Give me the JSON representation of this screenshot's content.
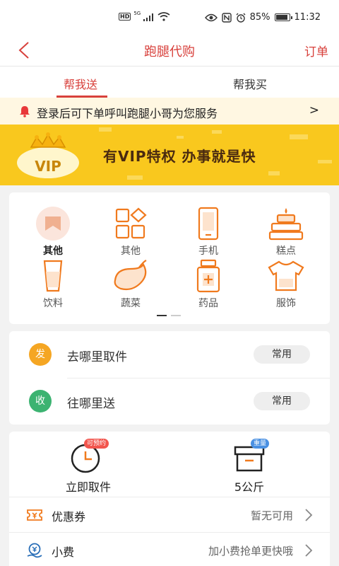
{
  "status_bar": {
    "left_badges": [
      "HD",
      "5G"
    ],
    "battery_percent": "85%",
    "time": "11:32",
    "icons": [
      "eye-icon",
      "nfc-icon",
      "alarm-icon",
      "battery-icon",
      "signal-icon",
      "wifi-icon"
    ]
  },
  "nav": {
    "title": "跑腿代购",
    "order_label": "订单",
    "back_icon": "chevron-left-icon"
  },
  "tabs": [
    {
      "label": "帮我送",
      "active": true
    },
    {
      "label": "帮我买",
      "active": false
    }
  ],
  "notice": {
    "text": "登录后可下单呼叫跑腿小哥为您服务",
    "arrow": ">",
    "icon": "bell-icon"
  },
  "banner": {
    "badge_text": "VIP",
    "slogan": "有VIP特权  办事就是快"
  },
  "categories": [
    {
      "label": "其他",
      "icon": "bookmark-icon",
      "selected": true
    },
    {
      "label": "其他",
      "icon": "grid-icon",
      "selected": false
    },
    {
      "label": "手机",
      "icon": "phone-icon",
      "selected": false
    },
    {
      "label": "糕点",
      "icon": "cake-icon",
      "selected": false
    },
    {
      "label": "饮料",
      "icon": "cup-icon",
      "selected": false
    },
    {
      "label": "蔬菜",
      "icon": "eggplant-icon",
      "selected": false
    },
    {
      "label": "药品",
      "icon": "medicine-icon",
      "selected": false
    },
    {
      "label": "服饰",
      "icon": "shirt-icon",
      "selected": false
    }
  ],
  "category_page": {
    "current": 1,
    "total": 2
  },
  "address": {
    "pickup": {
      "tag": "发",
      "text": "去哪里取件",
      "button": "常用",
      "tag_color": "#f5a623"
    },
    "delivery": {
      "tag": "收",
      "text": "往哪里送",
      "button": "常用",
      "tag_color": "#3cb371"
    }
  },
  "options": {
    "pickup_time": {
      "badge": "可预约",
      "label": "立即取件",
      "icon": "clock-icon"
    },
    "weight": {
      "badge": "重量",
      "label": "5公斤",
      "icon": "box-icon"
    }
  },
  "rows": [
    {
      "label": "优惠券",
      "value": "暂无可用",
      "icon": "coupon-icon"
    },
    {
      "label": "小费",
      "value": "加小费抢单更快哦",
      "icon": "tip-icon"
    }
  ],
  "colors": {
    "accent": "#d8413c",
    "icon_orange": "#f07a1e",
    "banner_yellow": "#f9c81e",
    "notice_bg": "#fff7e2"
  }
}
